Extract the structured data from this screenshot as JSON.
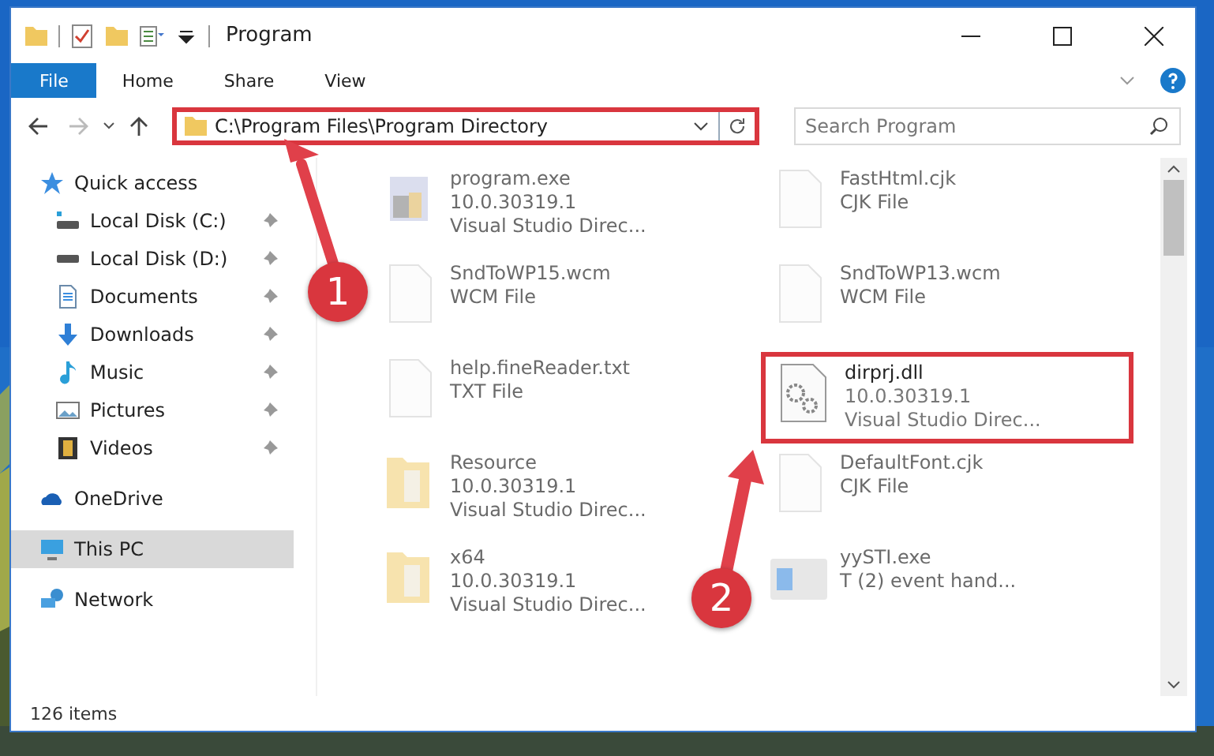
{
  "window": {
    "title": "Program"
  },
  "ribbon_tabs": [
    {
      "label": "File",
      "selected": true
    },
    {
      "label": "Home",
      "selected": false
    },
    {
      "label": "Share",
      "selected": false
    },
    {
      "label": "View",
      "selected": false
    }
  ],
  "address_bar": {
    "path": "C:\\Program Files\\Program Directory",
    "callout": "1"
  },
  "search": {
    "placeholder": "Search Program"
  },
  "sidebar": {
    "items": [
      {
        "label": "Quick access",
        "kind": "quick",
        "selected": false,
        "children": [
          {
            "label": "Local Disk (C:)",
            "kind": "drive-c",
            "pinned": true
          },
          {
            "label": "Local Disk (D:)",
            "kind": "drive",
            "pinned": true
          },
          {
            "label": "Documents",
            "kind": "documents",
            "pinned": true
          },
          {
            "label": "Downloads",
            "kind": "downloads",
            "pinned": true
          },
          {
            "label": "Music",
            "kind": "music",
            "pinned": true
          },
          {
            "label": "Pictures",
            "kind": "pictures",
            "pinned": true
          },
          {
            "label": "Videos",
            "kind": "videos",
            "pinned": true
          }
        ]
      },
      {
        "label": "OneDrive",
        "kind": "onedrive",
        "selected": false
      },
      {
        "label": "This PC",
        "kind": "pc",
        "selected": true
      },
      {
        "label": "Network",
        "kind": "network",
        "selected": false
      }
    ]
  },
  "files": [
    {
      "name": "program.exe",
      "details": [
        "10.0.30319.1",
        "Visual Studio Direc..."
      ],
      "kind": "exe",
      "faded": true
    },
    {
      "name": "SndToWP15.wcm",
      "details": [
        "WCM File"
      ],
      "kind": "doc",
      "faded": true
    },
    {
      "name": "help.fineReader.txt",
      "details": [
        "TXT File"
      ],
      "kind": "doc",
      "faded": true
    },
    {
      "name": "Resource",
      "details": [
        "10.0.30319.1",
        "Visual Studio Direc..."
      ],
      "kind": "folder",
      "faded": true
    },
    {
      "name": "x64",
      "details": [
        "10.0.30319.1",
        "Visual Studio Direc..."
      ],
      "kind": "folder",
      "faded": true
    },
    {
      "name": "FastHtml.cjk",
      "details": [
        "CJK File"
      ],
      "kind": "doc",
      "faded": true
    },
    {
      "name": "SndToWP13.wcm",
      "details": [
        "WCM File"
      ],
      "kind": "doc",
      "faded": true
    },
    {
      "name": "dirprj.dll",
      "details": [
        "10.0.30319.1",
        "Visual Studio Direc..."
      ],
      "kind": "dll",
      "faded": false,
      "callout": "2"
    },
    {
      "name": "DefaultFont.cjk",
      "details": [
        "CJK File"
      ],
      "kind": "doc",
      "faded": true
    },
    {
      "name": "yySTI.exe",
      "details": [
        "T (2) event hand..."
      ],
      "kind": "app",
      "faded": true
    }
  ],
  "status_bar": {
    "count": "126 items"
  }
}
